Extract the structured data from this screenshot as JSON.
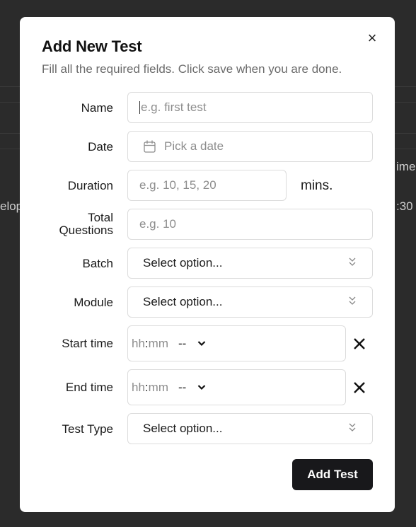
{
  "background": {
    "fragments": [
      "ime",
      "elop",
      ":30"
    ]
  },
  "modal": {
    "title": "Add New Test",
    "subtitle": "Fill all the required fields. Click save when you are done.",
    "close_symbol": "×"
  },
  "form": {
    "name": {
      "label": "Name",
      "placeholder": "e.g. first test",
      "value": ""
    },
    "date": {
      "label": "Date",
      "placeholder": "Pick a date",
      "icon": "calendar-icon"
    },
    "duration": {
      "label": "Duration",
      "placeholder": "e.g. 10, 15, 20",
      "suffix": "mins."
    },
    "total_questions": {
      "label_line1": "Total",
      "label_line2": "Questions",
      "placeholder": "e.g. 10"
    },
    "batch": {
      "label": "Batch",
      "selected": "Select option..."
    },
    "module": {
      "label": "Module",
      "selected": "Select option..."
    },
    "start_time": {
      "label": "Start time",
      "hours": "hh",
      "sep": ":",
      "minutes": "mm",
      "ampm": "--"
    },
    "end_time": {
      "label": "End time",
      "hours": "hh",
      "sep": ":",
      "minutes": "mm",
      "ampm": "--"
    },
    "test_type": {
      "label": "Test Type",
      "selected": "Select option..."
    }
  },
  "actions": {
    "submit_label": "Add Test"
  },
  "colors": {
    "primary_button": "#18181b",
    "overlay": "#2b2b2b"
  }
}
